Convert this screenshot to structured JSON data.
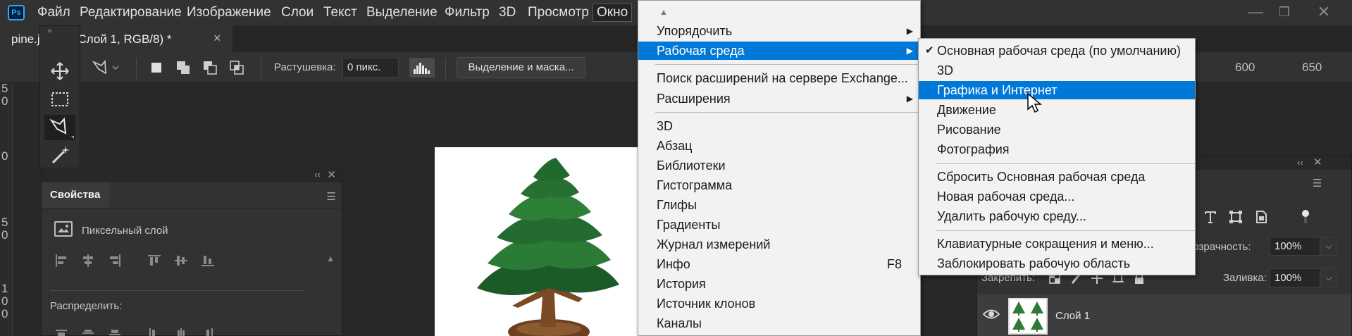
{
  "app": {
    "logo_text": "Ps",
    "menubar": [
      "Файл",
      "Редактирование",
      "Изображение",
      "Слои",
      "Текст",
      "Выделение",
      "Фильтр",
      "3D",
      "Просмотр",
      "Окно"
    ],
    "active_menu": "Окно",
    "window_controls": {
      "minimize": "—",
      "restore": "❐",
      "close": "✕"
    }
  },
  "document_tab": {
    "label": "pine.j        6.7% (Слой 1, RGB/8) *",
    "close": "×"
  },
  "options_bar": {
    "feather_label": "Растушевка:",
    "feather_value": "0 пикс.",
    "select_and_mask": "Выделение и маска..."
  },
  "toolbar": {
    "header": "»",
    "tools": [
      "move-tool",
      "marquee-tool",
      "polygonal-lasso-tool",
      "magic-wand-tool"
    ],
    "active_tool": "polygonal-lasso-tool"
  },
  "rulers": {
    "vertical": [
      "5",
      "0",
      "0",
      "5",
      "0",
      "1",
      "0",
      "0"
    ],
    "horizontal": [
      "600",
      "650"
    ]
  },
  "properties_panel": {
    "tab": "Свойства",
    "collapse": "‹‹",
    "close": "✕",
    "layer_type": "Пиксельный слой",
    "distribute_label": "Распределить:"
  },
  "layers_panel": {
    "collapse": "‹‹",
    "close": "✕",
    "opacity_label": "розрачность:",
    "opacity_value": "100%",
    "lock_label": "Закрепить:",
    "fill_label": "Заливка:",
    "fill_value": "100%",
    "layer_name": "Слой 1"
  },
  "window_menu": {
    "items": [
      {
        "label": "Упорядочить",
        "submenu": true
      },
      {
        "label": "Рабочая среда",
        "submenu": true,
        "highlighted": true
      },
      {
        "label": "Поиск расширений на сервере Exchange..."
      },
      {
        "label": "Расширения",
        "submenu": true
      },
      {
        "label": "3D"
      },
      {
        "label": "Абзац"
      },
      {
        "label": "Библиотеки"
      },
      {
        "label": "Гистограмма"
      },
      {
        "label": "Глифы"
      },
      {
        "label": "Градиенты"
      },
      {
        "label": "Журнал измерений"
      },
      {
        "label": "Инфо",
        "shortcut": "F8"
      },
      {
        "label": "История"
      },
      {
        "label": "Источник клонов"
      },
      {
        "label": "Каналы"
      }
    ]
  },
  "workspace_menu": {
    "items": [
      {
        "label": "Основная рабочая среда (по умолчанию)",
        "checked": true
      },
      {
        "label": "3D"
      },
      {
        "label": "Графика и Интернет",
        "highlighted": true
      },
      {
        "label": "Движение"
      },
      {
        "label": "Рисование"
      },
      {
        "label": "Фотография"
      },
      {
        "label": "Сбросить Основная рабочая среда"
      },
      {
        "label": "Новая рабочая среда..."
      },
      {
        "label": "Удалить рабочую среду..."
      },
      {
        "label": "Клавиатурные сокращения и меню..."
      },
      {
        "label": "Заблокировать рабочую область"
      }
    ]
  },
  "colors": {
    "highlight": "#0078d7",
    "ui_dark": "#323232",
    "menu_bg": "#f2f2f2"
  }
}
